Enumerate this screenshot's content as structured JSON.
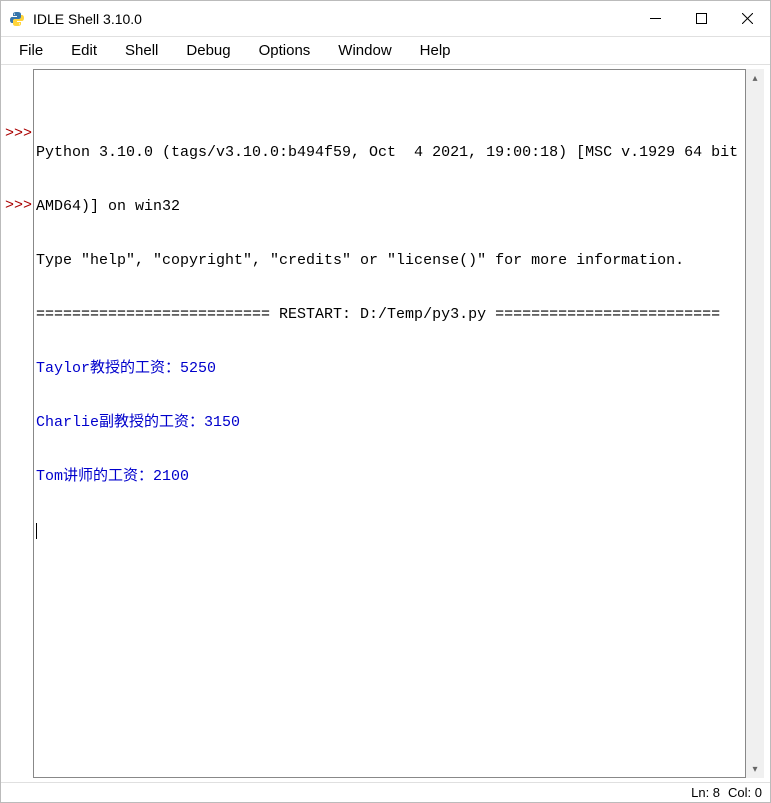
{
  "window": {
    "title": "IDLE Shell 3.10.0"
  },
  "menu": {
    "items": [
      "File",
      "Edit",
      "Shell",
      "Debug",
      "Options",
      "Window",
      "Help"
    ]
  },
  "shell": {
    "prompt": ">>>",
    "version_line1": "Python 3.10.0 (tags/v3.10.0:b494f59, Oct  4 2021, 19:00:18) [MSC v.1929 64 bit (",
    "version_line2": "AMD64)] on win32",
    "version_line3": "Type \"help\", \"copyright\", \"credits\" or \"license()\" for more information.",
    "restart_line": "========================== RESTART: D:/Temp/py3.py =========================",
    "output": [
      "Taylor教授的工资：5250",
      "Charlie副教授的工资：3150",
      "Tom讲师的工资：2100"
    ]
  },
  "status": {
    "line": "Ln: 8",
    "col": "Col: 0"
  }
}
